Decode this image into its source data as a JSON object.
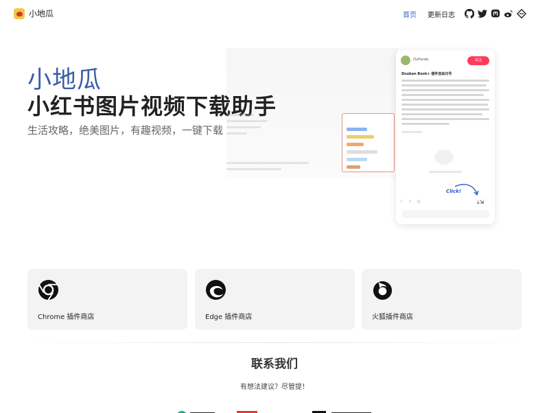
{
  "header": {
    "brand_name": "小地瓜",
    "nav": [
      {
        "label": "首页"
      },
      {
        "label": "更新日志"
      }
    ],
    "social_icons": [
      "github-icon",
      "twitter-icon",
      "mastodon-icon",
      "weibo-icon",
      "sspai-icon"
    ]
  },
  "hero": {
    "title": "小地瓜",
    "headline": "小红书图片视频下载助手",
    "subtitle": "生活攻略，绝美图片，有趣视频，一键下载"
  },
  "preview": {
    "username": "OuPanda",
    "follow_label": "关注",
    "post_title": "Douban Book+ 插件自由日号",
    "click_label": "Click!"
  },
  "stores": [
    {
      "label": "Chrome 插件商店",
      "icon": "chrome-icon"
    },
    {
      "label": "Edge 插件商店",
      "icon": "edge-icon"
    },
    {
      "label": "火狐插件商店",
      "icon": "firefox-icon"
    }
  ],
  "contact": {
    "title": "联系我们",
    "subtitle": "有想法建议？尽管提！"
  },
  "colors": {
    "accent": "#3c5ca8",
    "follow": "#ff3b5c",
    "card_bg": "#f3f3f3"
  }
}
